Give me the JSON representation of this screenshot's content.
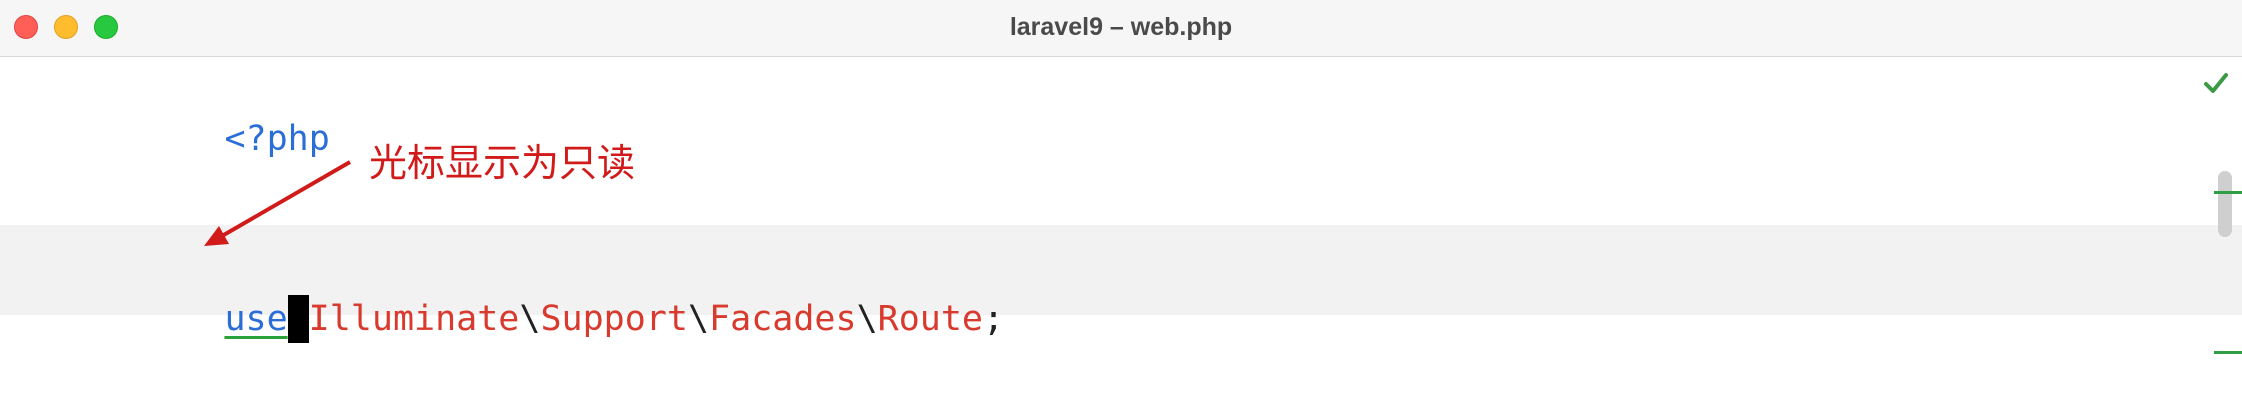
{
  "window": {
    "title": "laravel9 – web.php"
  },
  "editor": {
    "line1": {
      "text": "<?php"
    },
    "line3": {
      "keyword": "use",
      "namespace_parts": [
        "Illuminate",
        "Support",
        "Facades",
        "Route"
      ],
      "separator": "\\",
      "terminator": ";"
    }
  },
  "annotation": {
    "text": "光标显示为只读",
    "color": "#d11a1a"
  },
  "icons": {
    "status": "check-icon",
    "window_controls": [
      "close-button",
      "minimize-button",
      "zoom-button"
    ]
  },
  "colors": {
    "keyword": "#2b6fd6",
    "namespace": "#d83a2e",
    "current_line_bg": "#f2f2f2",
    "underline": "#2aa23a"
  }
}
